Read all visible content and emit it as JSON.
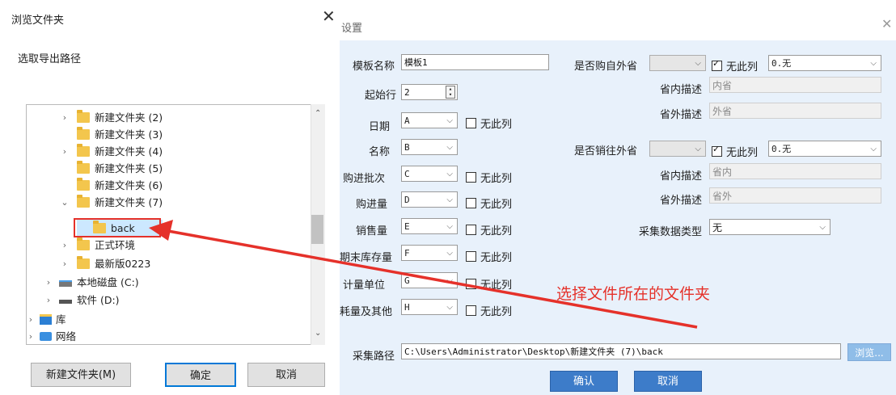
{
  "browse_dialog": {
    "title": "浏览文件夹",
    "close": "✕",
    "description": "选取导出路径",
    "tree_items": [
      {
        "label": "新建文件夹 (2)",
        "arrow": "›"
      },
      {
        "label": "新建文件夹 (3)",
        "arrow": ""
      },
      {
        "label": "新建文件夹 (4)",
        "arrow": "›"
      },
      {
        "label": "新建文件夹 (5)",
        "arrow": ""
      },
      {
        "label": "新建文件夹 (6)",
        "arrow": ""
      },
      {
        "label": "新建文件夹 (7)",
        "arrow": "⌄"
      },
      {
        "label": "back",
        "arrow": ""
      },
      {
        "label": "正式环境",
        "arrow": "›"
      },
      {
        "label": "最新版0223",
        "arrow": "›"
      },
      {
        "label": "本地磁盘 (C:)",
        "arrow": "›"
      },
      {
        "label": "软件 (D:)",
        "arrow": "›"
      },
      {
        "label": "库",
        "arrow": "›"
      },
      {
        "label": "网络",
        "arrow": "›"
      }
    ],
    "buttons": {
      "new_folder": "新建文件夹(M)",
      "ok": "确定",
      "cancel": "取消"
    }
  },
  "settings_dialog": {
    "title": "设置",
    "close": "✕",
    "template_name": {
      "label": "模板名称",
      "value": "模板1"
    },
    "start_row": {
      "label": "起始行",
      "value": "2"
    },
    "column_fields": [
      {
        "label": "日期",
        "value": "A",
        "no_col": "无此列"
      },
      {
        "label": "名称",
        "value": "B",
        "no_col": ""
      },
      {
        "label": "购进批次",
        "value": "C",
        "no_col": "无此列"
      },
      {
        "label": "购进量",
        "value": "D",
        "no_col": "无此列"
      },
      {
        "label": "销售量",
        "value": "E",
        "no_col": "无此列"
      },
      {
        "label": "期末库存量",
        "value": "F",
        "no_col": "无此列"
      },
      {
        "label": "计量单位",
        "value": "G",
        "no_col": "无此列"
      },
      {
        "label": "耗量及其他",
        "value": "H",
        "no_col": "无此列"
      }
    ],
    "buy_outside": {
      "label": "是否购自外省",
      "select": "",
      "no_col": "无此列",
      "value": "0.无",
      "inner_label": "省内描述",
      "inner_value": "内省",
      "outer_label": "省外描述",
      "outer_value": "外省"
    },
    "sell_outside": {
      "label": "是否销往外省",
      "select": "",
      "no_col": "无此列",
      "value": "0.无",
      "inner_label": "省内描述",
      "inner_value": "省内",
      "outer_label": "省外描述",
      "outer_value": "省外"
    },
    "collect_type": {
      "label": "采集数据类型",
      "value": "无"
    },
    "collect_path": {
      "label": "采集路径",
      "value": "C:\\Users\\Administrator\\Desktop\\新建文件夹 (7)\\back",
      "browse": "浏览..."
    },
    "buttons": {
      "ok": "确认",
      "cancel": "取消"
    }
  },
  "annotation": {
    "text": "选择文件所在的文件夹",
    "color": "#e5312a"
  }
}
